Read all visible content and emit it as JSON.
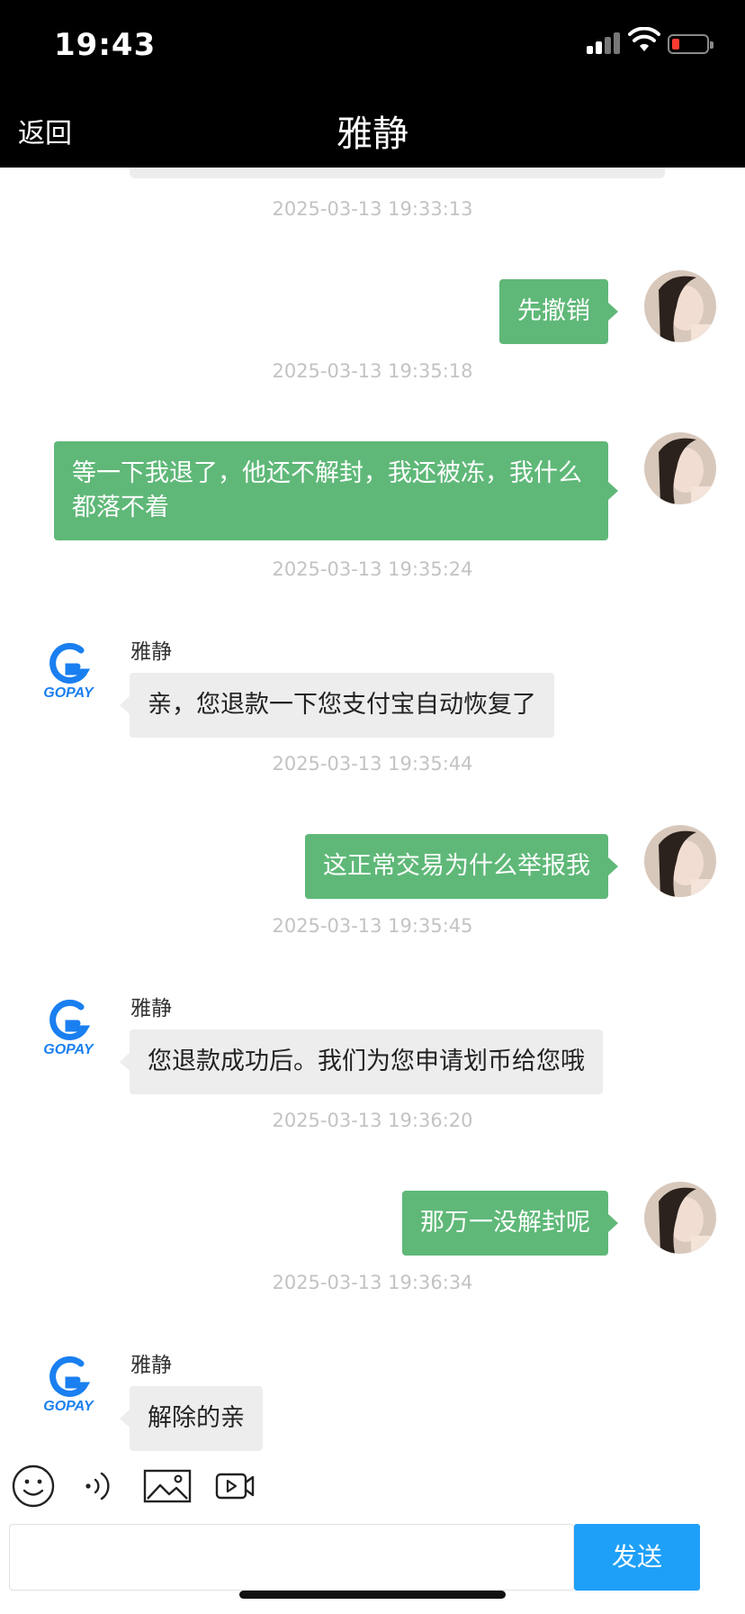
{
  "status": {
    "time": "19:43"
  },
  "nav": {
    "back_label": "返回",
    "title": "雅静"
  },
  "messages": [
    {
      "timestamp": "2025-03-13 19:33:13",
      "direction": "out",
      "text": "先撤销"
    },
    {
      "timestamp": "2025-03-13 19:35:18",
      "direction": "out",
      "text": "等一下我退了，他还不解封，我还被冻，我什么都落不着"
    },
    {
      "timestamp": "2025-03-13 19:35:24",
      "direction": "in",
      "sender": "雅静",
      "text": "亲，您退款一下您支付宝自动恢复了"
    },
    {
      "timestamp": "2025-03-13 19:35:44",
      "direction": "out",
      "text": "这正常交易为什么举报我"
    },
    {
      "timestamp": "2025-03-13 19:35:45",
      "direction": "in",
      "sender": "雅静",
      "text": "您退款成功后。我们为您申请划币给您哦"
    },
    {
      "timestamp": "2025-03-13 19:36:20",
      "direction": "out",
      "text": "那万一没解封呢"
    },
    {
      "timestamp": "2025-03-13 19:36:34",
      "direction": "in",
      "sender": "雅静",
      "text": "解除的亲"
    }
  ],
  "brand": {
    "logo_text": "GOPAY",
    "logo_color": "#1a7ff0"
  },
  "colors": {
    "outgoing_bubble": "#5fb878",
    "incoming_bubble": "#ededed",
    "send_button": "#1fa0f8"
  },
  "toolbar": {
    "icons": [
      "emoji-icon",
      "voice-icon",
      "image-icon",
      "video-icon"
    ]
  },
  "composer": {
    "input_value": "",
    "send_label": "发送"
  }
}
